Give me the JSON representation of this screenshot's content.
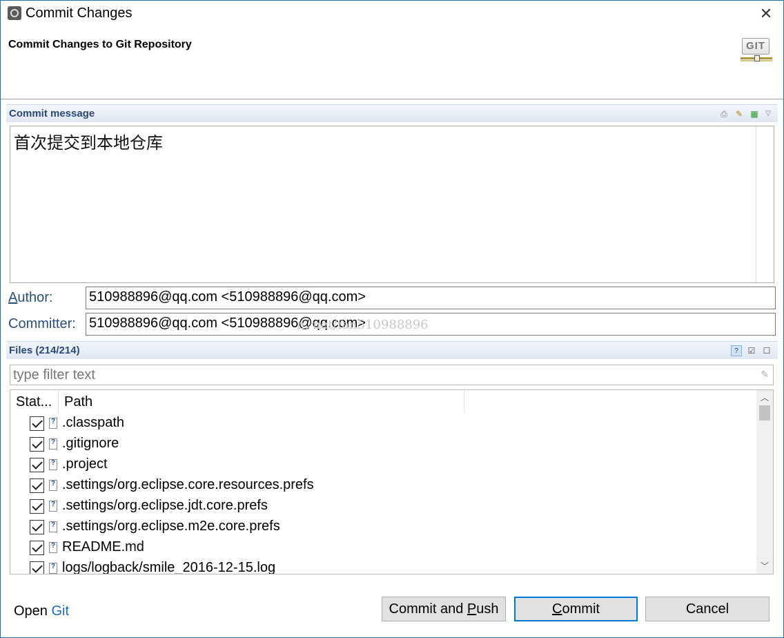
{
  "window": {
    "title": "Commit Changes",
    "close_glyph": "✕"
  },
  "banner": {
    "title": "Commit Changes to Git Repository",
    "git_logo_text": "GIT"
  },
  "commit_message": {
    "section_label": "Commit message",
    "text": "首次提交到本地仓库"
  },
  "author": {
    "label_mnemonic": "A",
    "label_rest": "uthor:",
    "value": "510988896@qq.com <510988896@qq.com>"
  },
  "committer": {
    "label": "Committer:",
    "value": "510988896@qq.com <510988896@qq.com>"
  },
  "watermark": "n. net/fan510988896",
  "files": {
    "section_label": "Files (214/214)",
    "filter_placeholder": "type filter text",
    "columns": {
      "status": "Stat...",
      "path": "Path"
    },
    "rows": [
      ".classpath",
      ".gitignore",
      ".project",
      ".settings/org.eclipse.core.resources.prefs",
      ".settings/org.eclipse.jdt.core.prefs",
      ".settings/org.eclipse.m2e.core.prefs",
      "README.md",
      "logs/logback/smile_2016-12-15.log"
    ]
  },
  "footer": {
    "open_label": "Open",
    "open_link": "Git",
    "commit_push_pre": "Commit and ",
    "commit_push_mnemonic": "P",
    "commit_push_post": "ush",
    "commit_mnemonic": "C",
    "commit_rest": "ommit",
    "cancel": "Cancel"
  }
}
